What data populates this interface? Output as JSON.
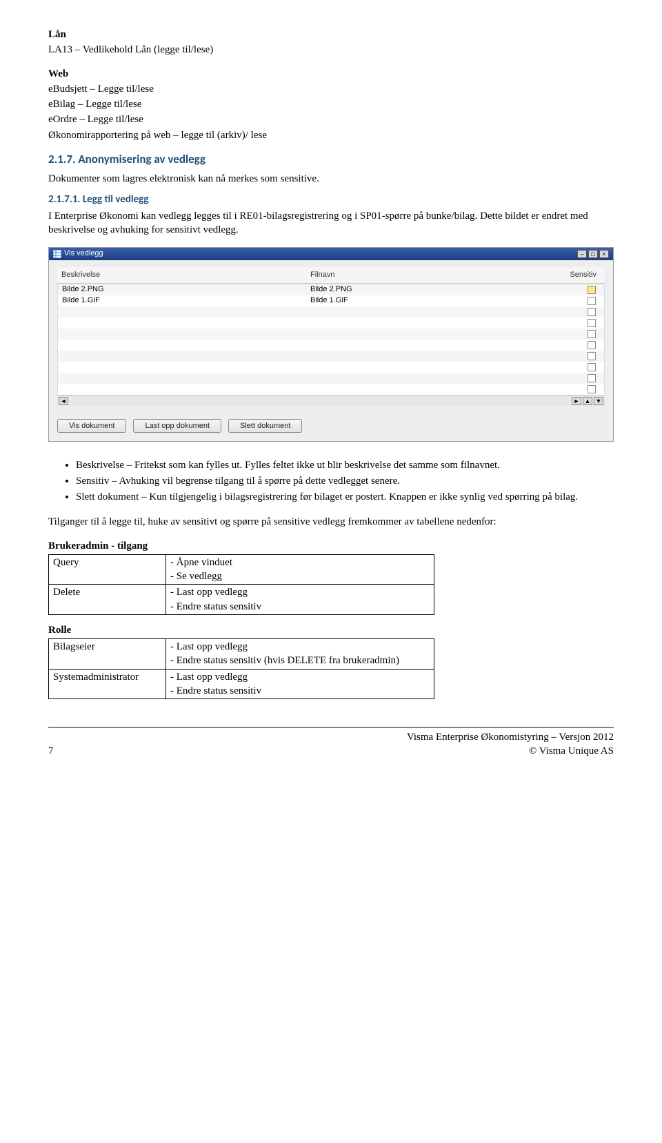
{
  "doc": {
    "h_lan": "Lån",
    "la13": "LA13 – Vedlikehold Lån (legge til/lese)",
    "h_web": "Web",
    "web_lines": [
      "eBudsjett – Legge til/lese",
      "eBilag – Legge til/lese",
      "eOrdre – Legge til/lese",
      "Økonomirapportering på web – legge til (arkiv)/ lese"
    ],
    "sec_num": "2.1.7.",
    "sec_title": "Anonymisering av vedlegg",
    "sec_intro": "Dokumenter som lagres elektronisk kan nå merkes som sensitive.",
    "sub_num": "2.1.7.1.",
    "sub_title": "Legg til vedlegg",
    "sub_body": "I Enterprise Økonomi kan vedlegg legges til i RE01-bilagsregistrering og i SP01-spørre på bunke/bilag. Dette bildet er endret med beskrivelse og avhuking for sensitivt vedlegg.",
    "bullets": [
      "Beskrivelse – Fritekst som kan fylles ut. Fylles feltet ikke ut blir beskrivelse det samme som filnavnet.",
      "Sensitiv – Avhuking vil begrense tilgang til å spørre på dette vedlegget senere.",
      "Slett dokument – Kun tilgjengelig i bilagsregistrering før bilaget er postert. Knappen er ikke synlig ved spørring på bilag."
    ],
    "tilgang_intro": "Tilganger til å legge til, huke av sensitivt og spørre på sensitive vedlegg fremkommer av tabellene nedenfor:",
    "brukeradmin_h": "Brukeradmin - tilgang",
    "tbl1": {
      "rows": [
        {
          "k": "Query",
          "items": [
            "Åpne vinduet",
            "Se vedlegg"
          ]
        },
        {
          "k": "Delete",
          "items": [
            "Last opp vedlegg",
            "Endre status sensitiv"
          ]
        }
      ]
    },
    "rolle_h": "Rolle",
    "tbl2": {
      "rows": [
        {
          "k": "Bilagseier",
          "items": [
            "Last opp vedlegg",
            "Endre status sensitiv (hvis DELETE fra brukeradmin)"
          ]
        },
        {
          "k": "Systemadministrator",
          "items": [
            "Last opp vedlegg",
            "Endre status sensitiv"
          ]
        }
      ]
    },
    "footer": {
      "page": "7",
      "line1": "Visma Enterprise Økonomistyring – Versjon 2012",
      "line2": "© Visma Unique AS"
    }
  },
  "window": {
    "title": "Vis vedlegg",
    "icon_name": "worksheet-icon",
    "columns": {
      "beskrivelse": "Beskrivelse",
      "filnavn": "Filnavn",
      "sensitiv": "Sensitiv"
    },
    "rows": [
      {
        "beskrivelse": "Bilde 2.PNG",
        "filnavn": "Bilde 2.PNG",
        "sensitiv_checked": false,
        "highlight": true
      },
      {
        "beskrivelse": "Bilde 1.GIF",
        "filnavn": "Bilde 1.GIF",
        "sensitiv_checked": false,
        "highlight": false
      }
    ],
    "empty_rows": 8,
    "buttons": {
      "view": "Vis dokument",
      "upload": "Last opp dokument",
      "delete": "Slett dokument"
    }
  }
}
